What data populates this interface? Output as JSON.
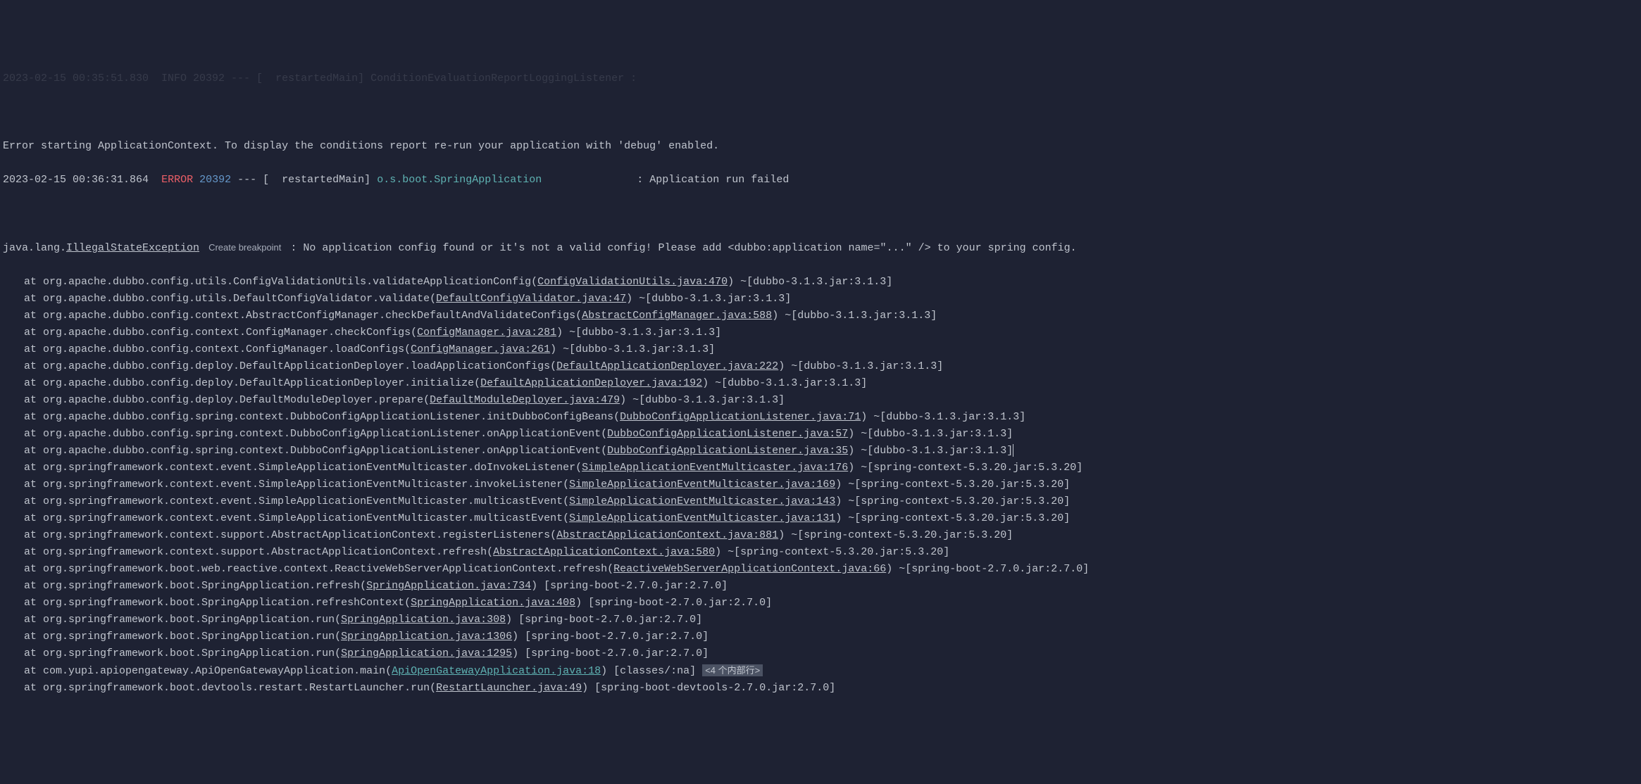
{
  "lines": {
    "top_partial": "2023-02-15 00:35:51.830  INFO 20392 --- [  restartedMain] ConditionEvaluationReportLoggingListener :",
    "error_context": "Error starting ApplicationContext. To display the conditions report re-run your application with 'debug' enabled.",
    "header": {
      "timestamp": "2023-02-15 00:36:31.864",
      "level": "ERROR",
      "pid": "20392",
      "separator": "---",
      "thread": "[  restartedMain]",
      "logger": "o.s.boot.SpringApplication",
      "message": ": Application run failed"
    },
    "exception": {
      "prefix": "java.lang.",
      "class_name": "IllegalStateException",
      "create_breakpoint": "Create breakpoint",
      "message": ": No application config found or it's not a valid config! Please add <dubbo:application name=\"...\" /> to your spring config."
    }
  },
  "stack": [
    {
      "prefix": "at org.apache.dubbo.config.utils.ConfigValidationUtils.validateApplicationConfig(",
      "link": "ConfigValidationUtils.java:470",
      "suffix": ") ~[dubbo-3.1.3.jar:3.1.3]"
    },
    {
      "prefix": "at org.apache.dubbo.config.utils.DefaultConfigValidator.validate(",
      "link": "DefaultConfigValidator.java:47",
      "suffix": ") ~[dubbo-3.1.3.jar:3.1.3]"
    },
    {
      "prefix": "at org.apache.dubbo.config.context.AbstractConfigManager.checkDefaultAndValidateConfigs(",
      "link": "AbstractConfigManager.java:588",
      "suffix": ") ~[dubbo-3.1.3.jar:3.1.3]"
    },
    {
      "prefix": "at org.apache.dubbo.config.context.ConfigManager.checkConfigs(",
      "link": "ConfigManager.java:281",
      "suffix": ") ~[dubbo-3.1.3.jar:3.1.3]"
    },
    {
      "prefix": "at org.apache.dubbo.config.context.ConfigManager.loadConfigs(",
      "link": "ConfigManager.java:261",
      "suffix": ") ~[dubbo-3.1.3.jar:3.1.3]"
    },
    {
      "prefix": "at org.apache.dubbo.config.deploy.DefaultApplicationDeployer.loadApplicationConfigs(",
      "link": "DefaultApplicationDeployer.java:222",
      "suffix": ") ~[dubbo-3.1.3.jar:3.1.3]"
    },
    {
      "prefix": "at org.apache.dubbo.config.deploy.DefaultApplicationDeployer.initialize(",
      "link": "DefaultApplicationDeployer.java:192",
      "suffix": ") ~[dubbo-3.1.3.jar:3.1.3]"
    },
    {
      "prefix": "at org.apache.dubbo.config.deploy.DefaultModuleDeployer.prepare(",
      "link": "DefaultModuleDeployer.java:479",
      "suffix": ") ~[dubbo-3.1.3.jar:3.1.3]"
    },
    {
      "prefix": "at org.apache.dubbo.config.spring.context.DubboConfigApplicationListener.initDubboConfigBeans(",
      "link": "DubboConfigApplicationListener.java:71",
      "suffix": ") ~[dubbo-3.1.3.jar:3.1.3]"
    },
    {
      "prefix": "at org.apache.dubbo.config.spring.context.DubboConfigApplicationListener.onApplicationEvent(",
      "link": "DubboConfigApplicationListener.java:57",
      "suffix": ") ~[dubbo-3.1.3.jar:3.1.3]"
    },
    {
      "prefix": "at org.apache.dubbo.config.spring.context.DubboConfigApplicationListener.onApplicationEvent(",
      "link": "DubboConfigApplicationListener.java:35",
      "suffix": ") ~[dubbo-3.1.3.jar:3.1.3]",
      "caret": true
    },
    {
      "prefix": "at org.springframework.context.event.SimpleApplicationEventMulticaster.doInvokeListener(",
      "link": "SimpleApplicationEventMulticaster.java:176",
      "suffix": ") ~[spring-context-5.3.20.jar:5.3.20]"
    },
    {
      "prefix": "at org.springframework.context.event.SimpleApplicationEventMulticaster.invokeListener(",
      "link": "SimpleApplicationEventMulticaster.java:169",
      "suffix": ") ~[spring-context-5.3.20.jar:5.3.20]"
    },
    {
      "prefix": "at org.springframework.context.event.SimpleApplicationEventMulticaster.multicastEvent(",
      "link": "SimpleApplicationEventMulticaster.java:143",
      "suffix": ") ~[spring-context-5.3.20.jar:5.3.20]"
    },
    {
      "prefix": "at org.springframework.context.event.SimpleApplicationEventMulticaster.multicastEvent(",
      "link": "SimpleApplicationEventMulticaster.java:131",
      "suffix": ") ~[spring-context-5.3.20.jar:5.3.20]"
    },
    {
      "prefix": "at org.springframework.context.support.AbstractApplicationContext.registerListeners(",
      "link": "AbstractApplicationContext.java:881",
      "suffix": ") ~[spring-context-5.3.20.jar:5.3.20]"
    },
    {
      "prefix": "at org.springframework.context.support.AbstractApplicationContext.refresh(",
      "link": "AbstractApplicationContext.java:580",
      "suffix": ") ~[spring-context-5.3.20.jar:5.3.20]"
    },
    {
      "prefix": "at org.springframework.boot.web.reactive.context.ReactiveWebServerApplicationContext.refresh(",
      "link": "ReactiveWebServerApplicationContext.java:66",
      "suffix": ") ~[spring-boot-2.7.0.jar:2.7.0]"
    },
    {
      "prefix": "at org.springframework.boot.SpringApplication.refresh(",
      "link": "SpringApplication.java:734",
      "suffix": ") [spring-boot-2.7.0.jar:2.7.0]"
    },
    {
      "prefix": "at org.springframework.boot.SpringApplication.refreshContext(",
      "link": "SpringApplication.java:408",
      "suffix": ") [spring-boot-2.7.0.jar:2.7.0]"
    },
    {
      "prefix": "at org.springframework.boot.SpringApplication.run(",
      "link": "SpringApplication.java:308",
      "suffix": ") [spring-boot-2.7.0.jar:2.7.0]"
    },
    {
      "prefix": "at org.springframework.boot.SpringApplication.run(",
      "link": "SpringApplication.java:1306",
      "suffix": ") [spring-boot-2.7.0.jar:2.7.0]"
    },
    {
      "prefix": "at org.springframework.boot.SpringApplication.run(",
      "link": "SpringApplication.java:1295",
      "suffix": ") [spring-boot-2.7.0.jar:2.7.0]"
    },
    {
      "prefix": "at com.yupi.apiopengateway.ApiOpenGatewayApplication.main(",
      "link": "ApiOpenGatewayApplication.java:18",
      "suffix": ") [classes/:na]",
      "active": true,
      "internal_frames": "<4 个内部行>"
    },
    {
      "prefix": "at org.springframework.boot.devtools.restart.RestartLauncher.run(",
      "link": "RestartLauncher.java:49",
      "suffix": ") [spring-boot-devtools-2.7.0.jar:2.7.0]"
    }
  ]
}
